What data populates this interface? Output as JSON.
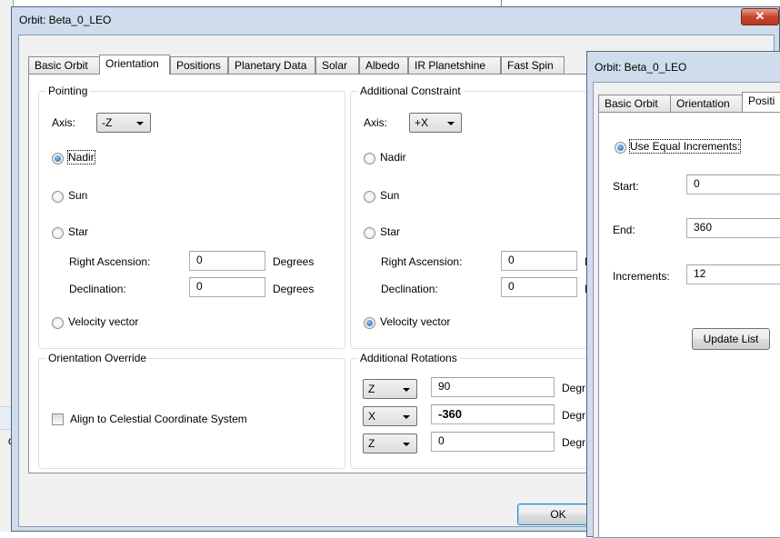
{
  "background": {
    "cut_text": "d"
  },
  "main": {
    "title": "Orbit: Beta_0_LEO",
    "close_glyph": "✕",
    "tabs": [
      {
        "label": "Basic Orbit"
      },
      {
        "label": "Orientation"
      },
      {
        "label": "Positions"
      },
      {
        "label": "Planetary Data"
      },
      {
        "label": "Solar"
      },
      {
        "label": "Albedo"
      },
      {
        "label": "IR Planetshine"
      },
      {
        "label": "Fast Spin"
      }
    ],
    "active_tab": "Orientation",
    "pointing": {
      "title": "Pointing",
      "axis_label": "Axis:",
      "axis_value": "-Z",
      "radios": [
        {
          "label": "Nadir",
          "checked": true
        },
        {
          "label": "Sun",
          "checked": false
        },
        {
          "label": "Star",
          "checked": false
        },
        {
          "label": "Velocity vector",
          "checked": false
        }
      ],
      "ra_label": "Right Ascension:",
      "ra_value": "0",
      "ra_unit": "Degrees",
      "dec_label": "Declination:",
      "dec_value": "0",
      "dec_unit": "Degrees"
    },
    "additional_constraint": {
      "title": "Additional Constraint",
      "axis_label": "Axis:",
      "axis_value": "+X",
      "radios": [
        {
          "label": "Nadir",
          "checked": false
        },
        {
          "label": "Sun",
          "checked": false
        },
        {
          "label": "Star",
          "checked": false
        },
        {
          "label": "Velocity vector",
          "checked": true
        }
      ],
      "ra_label": "Right Ascension:",
      "ra_value": "0",
      "ra_unit": "D",
      "dec_label": "Declination:",
      "dec_value": "0",
      "dec_unit": "D"
    },
    "orientation_override": {
      "title": "Orientation Override",
      "checkbox_label": "Align to Celestial Coordinate System",
      "checked": false
    },
    "additional_rotations": {
      "title": "Additional Rotations",
      "rows": [
        {
          "axis": "Z",
          "value": "90",
          "unit": "Degr"
        },
        {
          "axis": "X",
          "value": "-360",
          "unit": "Degr"
        },
        {
          "axis": "Z",
          "value": "0",
          "unit": "Degr"
        }
      ]
    },
    "ok_label": "OK"
  },
  "second": {
    "title": "Orbit: Beta_0_LEO",
    "tabs": [
      {
        "label": "Basic Orbit"
      },
      {
        "label": "Orientation"
      },
      {
        "label": "Positi"
      }
    ],
    "use_equal_label": "Use Equal Increments:",
    "use_equal_checked": true,
    "start_label": "Start:",
    "start_value": "0",
    "end_label": "End:",
    "end_value": "360",
    "increments_label": "Increments:",
    "increments_value": "12",
    "update_label": "Update List"
  }
}
